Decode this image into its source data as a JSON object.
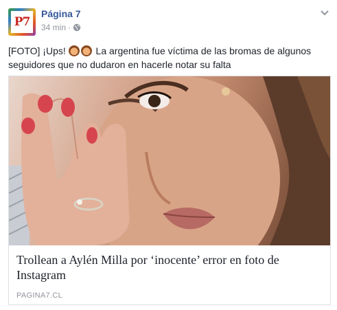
{
  "page": {
    "avatar_text": "P7",
    "name": "Página 7",
    "time": "34 min",
    "separator": "·",
    "privacy_icon": "globe-icon",
    "options_icon": "chevron-down-icon"
  },
  "message": {
    "prefix": "[FOTO] ¡Ups!",
    "emoji_icon": "man-facepalming-emoji",
    "text": "La argentina fue víctima de las bromas de algunos seguidores que no dudaron en hacerle notar su falta"
  },
  "link_card": {
    "image": "woman-covering-one-eye-photo",
    "title": "Trollean a Aylén Milla por ‘inocente’ error en foto de Instagram",
    "domain": "PAGINA7.CL"
  },
  "colors": {
    "page_name": "#365899",
    "meta": "#90949c",
    "text": "#1d2129",
    "border": "#dddfe2"
  }
}
